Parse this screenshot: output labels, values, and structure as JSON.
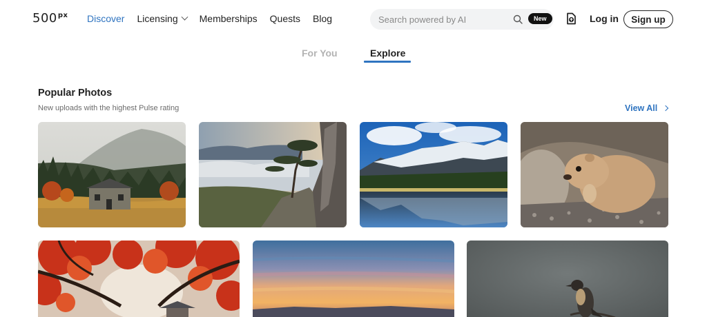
{
  "header": {
    "logo": "500",
    "logo_sup": "px",
    "nav": [
      {
        "label": "Discover",
        "active": true
      },
      {
        "label": "Licensing",
        "dropdown": true
      },
      {
        "label": "Memberships"
      },
      {
        "label": "Quests"
      },
      {
        "label": "Blog"
      }
    ],
    "search": {
      "placeholder": "Search powered by AI",
      "badge": "New"
    },
    "login_label": "Log in",
    "signup_label": "Sign up"
  },
  "tabs": [
    {
      "label": "For You",
      "active": false
    },
    {
      "label": "Explore",
      "active": true
    }
  ],
  "section": {
    "title": "Popular Photos",
    "subtitle": "New uploads with the highest Pulse rating",
    "view_all_label": "View All"
  },
  "colors": {
    "accent": "#2f74c0"
  }
}
